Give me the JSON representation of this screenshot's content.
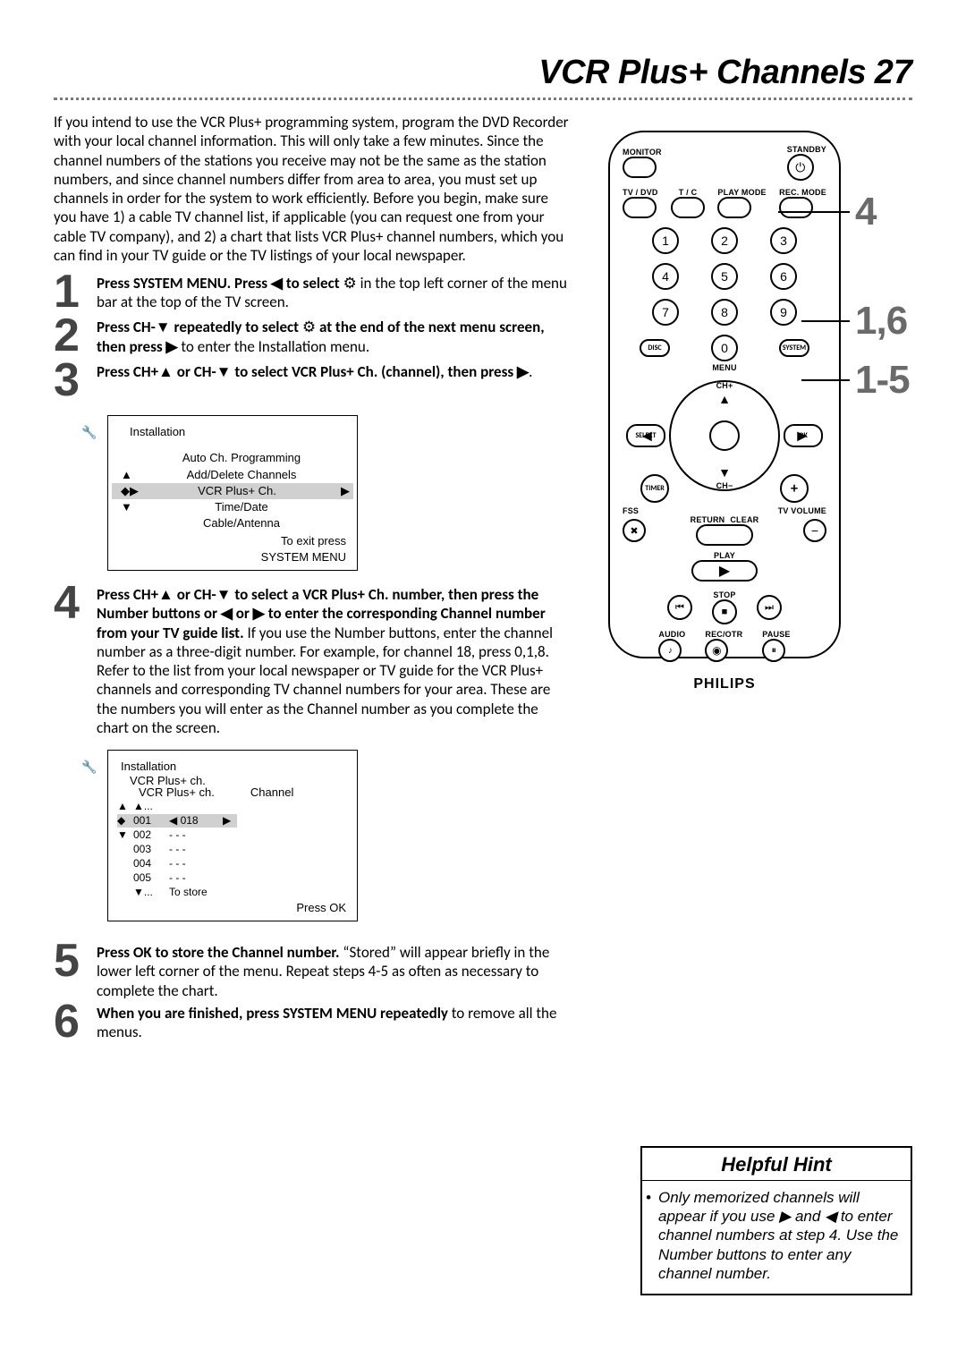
{
  "header": {
    "title": "VCR Plus+ Channels",
    "page": "27"
  },
  "intro": "If you intend to use the VCR Plus+ programming system, program the DVD Recorder with your local channel information. This will only take a few minutes. Since the channel numbers of the stations you receive may not be the same as the station numbers, and since channel numbers differ from area to area, you must set up channels in order for the system to work efficiently. Before you begin, make sure you have 1) a cable TV channel list, if applicable (you can request one from your cable TV company), and 2) a chart that lists VCR Plus+ channel numbers, which you can find in your TV guide or the TV listings of your local newspaper.",
  "steps": {
    "s1": {
      "num": "1",
      "bold": "Press SYSTEM MENU. Press ◀ to select",
      "tail": " in the top left corner of the menu bar at the top of the TV screen."
    },
    "s2": {
      "num": "2",
      "bold_a": "Press CH-▼ repeatedly to select ",
      "bold_b": " at the end of the next menu screen, then press ▶",
      "tail": " to enter the Installation menu."
    },
    "s3": {
      "num": "3",
      "bold": "Press CH+▲ or CH-▼ to select VCR Plus+ Ch. (channel), then press ▶",
      "tail": "."
    },
    "s4": {
      "num": "4",
      "bold": "Press CH+▲ or CH-▼ to select a VCR Plus+ Ch. number, then press the Number buttons or ◀ or ▶ to enter the corresponding Channel number from your TV guide list.",
      "tail": " If you use the Number buttons, enter the channel number as a three-digit number. For example, for channel 18, press 0,1,8.\nRefer to the list from your local newspaper or TV guide for the VCR Plus+ channels and corresponding TV channel numbers for your area. These are the numbers you will enter as the Channel number as you complete the chart on the screen."
    },
    "s5": {
      "num": "5",
      "bold": "Press OK to store the Channel number.",
      "tail": " “Stored” will appear briefly in the lower left corner of the menu. Repeat steps 4-5 as often as necessary to complete the chart."
    },
    "s6": {
      "num": "6",
      "bold": "When you are finished, press SYSTEM MENU repeatedly",
      "tail": " to remove all the menus."
    }
  },
  "osd1": {
    "title": "Installation",
    "items": [
      "Auto Ch. Programming",
      "Add/Delete Channels",
      "VCR Plus+ Ch.",
      "Time/Date",
      "Cable/Antenna"
    ],
    "selectedIndex": 2,
    "footer1": "To exit press",
    "footer2": "SYSTEM MENU"
  },
  "osd2": {
    "title": "Installation",
    "subtitle": "VCR Plus+ ch.",
    "col1": "VCR Plus+ ch.",
    "col2": "Channel",
    "rows": [
      {
        "mark": "▲",
        "vp": "▲...",
        "ch": ""
      },
      {
        "mark": "◆",
        "vp": "001",
        "ch": "◀ 018",
        "r": "▶",
        "sel": true
      },
      {
        "mark": "▼",
        "vp": "002",
        "ch": "- - -"
      },
      {
        "mark": "",
        "vp": "003",
        "ch": "- - -"
      },
      {
        "mark": "",
        "vp": "004",
        "ch": "- - -"
      },
      {
        "mark": "",
        "vp": "005",
        "ch": "- - -"
      },
      {
        "mark": "",
        "vp": "▼...",
        "ch": "To store"
      }
    ],
    "footer": "Press OK"
  },
  "remote": {
    "standby": "STANDBY",
    "monitor": "MONITOR",
    "row2": [
      "TV / DVD",
      "T / C",
      "PLAY MODE",
      "REC. MODE"
    ],
    "disc": "DISC",
    "system": "SYSTEM",
    "menu": "MENU",
    "select": "SELECT",
    "chp": "CH+",
    "chm": "CH−",
    "ok": "OK",
    "timer": "TIMER",
    "plus": "+",
    "fss": "FSS",
    "tvvol": "TV VOLUME",
    "return": "RETURN",
    "clear": "CLEAR",
    "play": "PLAY",
    "stop": "STOP",
    "audio": "AUDIO",
    "recotr": "REC/OTR",
    "pause": "PAUSE",
    "brand": "PHILIPS",
    "digits": [
      "1",
      "2",
      "3",
      "4",
      "5",
      "6",
      "7",
      "8",
      "9",
      "0"
    ]
  },
  "callouts": {
    "a": "4",
    "b": "1,6",
    "c": "1-5"
  },
  "hint": {
    "title": "Helpful Hint",
    "text": "Only memorized channels will appear if you use ▶ and ◀ to enter channel numbers at step 4. Use the Number buttons to enter any channel number."
  }
}
